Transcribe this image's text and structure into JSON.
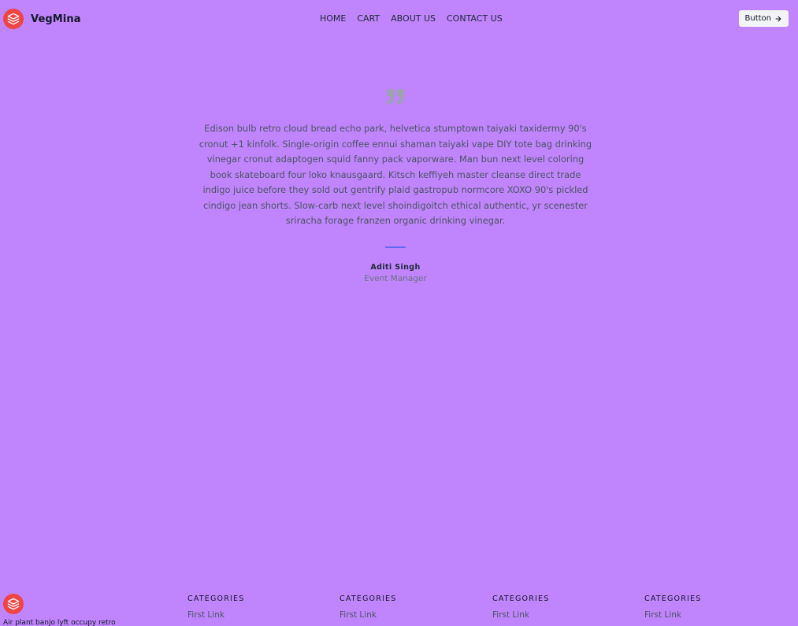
{
  "colors": {
    "background": "#c084fc",
    "brand": "#ef4444",
    "accent": "#6366f1",
    "quote": "#9ca3af"
  },
  "header": {
    "brand_name": "VegMina",
    "logo_icon": "layers-icon",
    "nav": [
      "HOME",
      "CART",
      "ABOUT US",
      "CONTACT US"
    ],
    "button_label": "Button",
    "button_icon": "arrow-right-icon"
  },
  "testimonial": {
    "quote_icon": "quote-icon",
    "text": "Edison bulb retro cloud bread echo park, helvetica stumptown taiyaki taxidermy 90's cronut +1 kinfolk. Single-origin coffee ennui shaman taiyaki vape DIY tote bag drinking vinegar cronut adaptogen squid fanny pack vaporware. Man bun next level coloring book skateboard four loko knausgaard. Kitsch keffiyeh master cleanse direct trade indigo juice before they sold out gentrify plaid gastropub normcore XOXO 90's pickled cindigo jean shorts. Slow-carb next level shoindigoitch ethical authentic, yr scenester sriracha forage franzen organic drinking vinegar.",
    "author_name": "Aditi Singh",
    "author_role": "Event Manager"
  },
  "footer": {
    "tagline": "Air plant banjo lyft occupy retro",
    "columns": [
      {
        "title": "CATEGORIES",
        "link": "First Link"
      },
      {
        "title": "CATEGORIES",
        "link": "First Link"
      },
      {
        "title": "CATEGORIES",
        "link": "First Link"
      },
      {
        "title": "CATEGORIES",
        "link": "First Link"
      }
    ]
  }
}
